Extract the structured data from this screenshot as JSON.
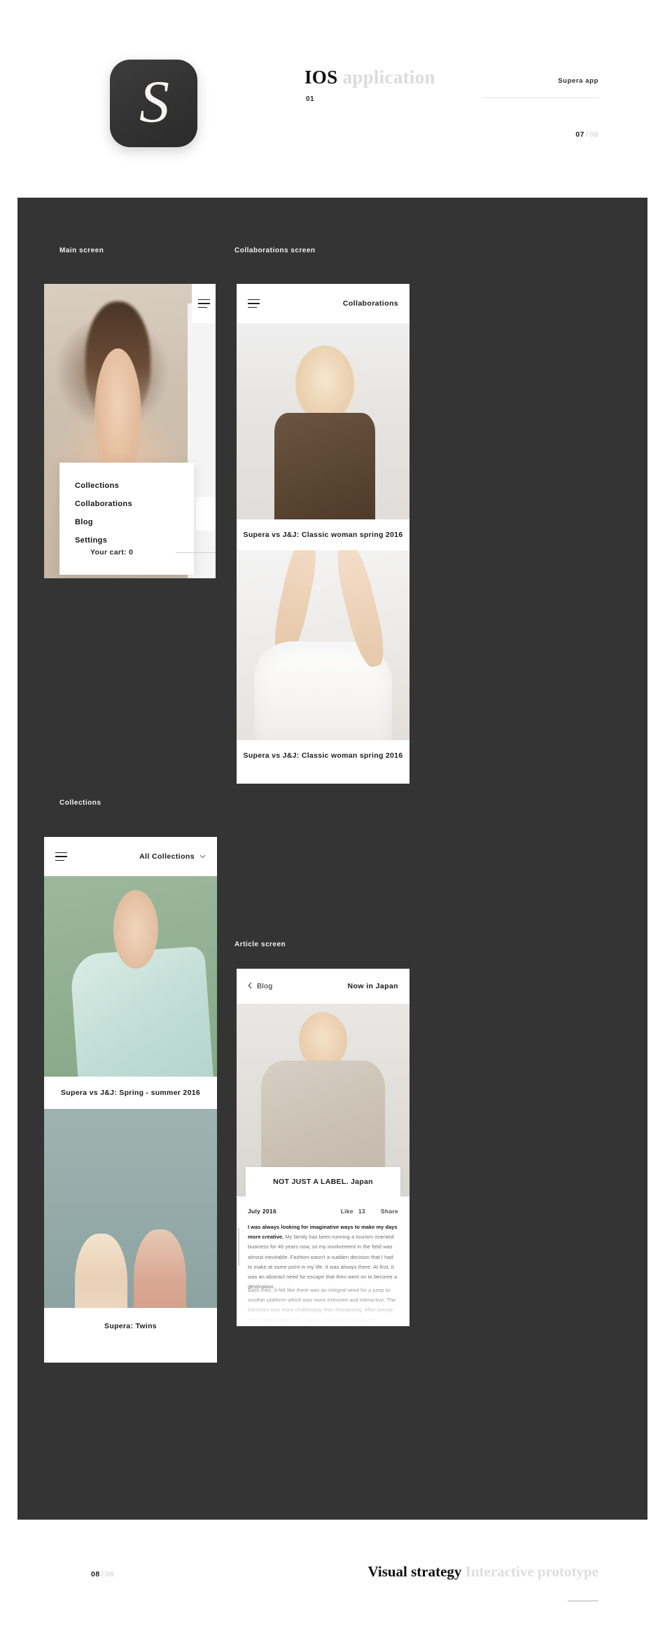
{
  "header": {
    "app_icon_glyph": "S",
    "title_main": "IOS",
    "title_muted": "application",
    "slide_number": "01",
    "right_label": "Supera app",
    "page_current": "07",
    "page_sep": "/",
    "page_total": "08"
  },
  "sections": {
    "main_screen": "Main screen",
    "collaborations_screen": "Collaborations screen",
    "collections": "Collections",
    "article_screen": "Article screen"
  },
  "main_screen": {
    "menu_items": [
      {
        "label": "Collections"
      },
      {
        "label": "Collaborations"
      },
      {
        "label": "Blog"
      },
      {
        "label": "Settings"
      }
    ],
    "cart_label": "Your cart: 0",
    "menu_icon": "hamburger-icon"
  },
  "collaborations_screen": {
    "nav_title": "Collaborations",
    "menu_icon": "hamburger-icon",
    "cards": [
      {
        "caption": "Supera vs J&J: Classic woman spring 2016"
      },
      {
        "caption": "Supera vs J&J: Classic woman spring 2016"
      }
    ]
  },
  "collections_screen": {
    "menu_icon": "hamburger-icon",
    "filter_label": "All Collections",
    "filter_icon": "chevron-down-icon",
    "cards": [
      {
        "caption": "Supera vs J&J: Spring - summer 2016"
      },
      {
        "caption": "Supera: Twins"
      }
    ]
  },
  "article_screen": {
    "back_icon": "chevron-left-icon",
    "back_label": "Blog",
    "nav_title": "Now in Japan",
    "hero_caption": "NOT JUST A LABEL. Japan",
    "date": "July 2016",
    "like_label": "Like",
    "like_count": "13",
    "share_label": "Share",
    "paragraph_lead": "I was always looking for imaginative ways to make my days more creative.",
    "paragraph_rest": " My family has been running a tourism oriented business for 40 years now, so my involvement in the field was almost inevitable. Fashion wasn't a sudden decision that I had to make at some point in my life. It was always there. At first, it was an abstract need for escape that then went on to become a destination.",
    "paragraph_two": "Back then, it felt like there was an integral need for a jump to another platform which was more extrovert and interactive. The transition was more challenging than threatening. After twenty-two Supera collections, I have come to realize that this transition was a kairotic moment in me, as that one when I reformed and developed myself as a designer."
  },
  "footer": {
    "page_current": "08",
    "page_sep": "/",
    "page_total": "08",
    "title_main": "Visual strategy",
    "title_muted": "Interactive prototype"
  },
  "colors": {
    "stage_bg": "#343434",
    "page_bg": "#ffffff",
    "ink": "#111111",
    "muted": "#dcdcdc"
  }
}
